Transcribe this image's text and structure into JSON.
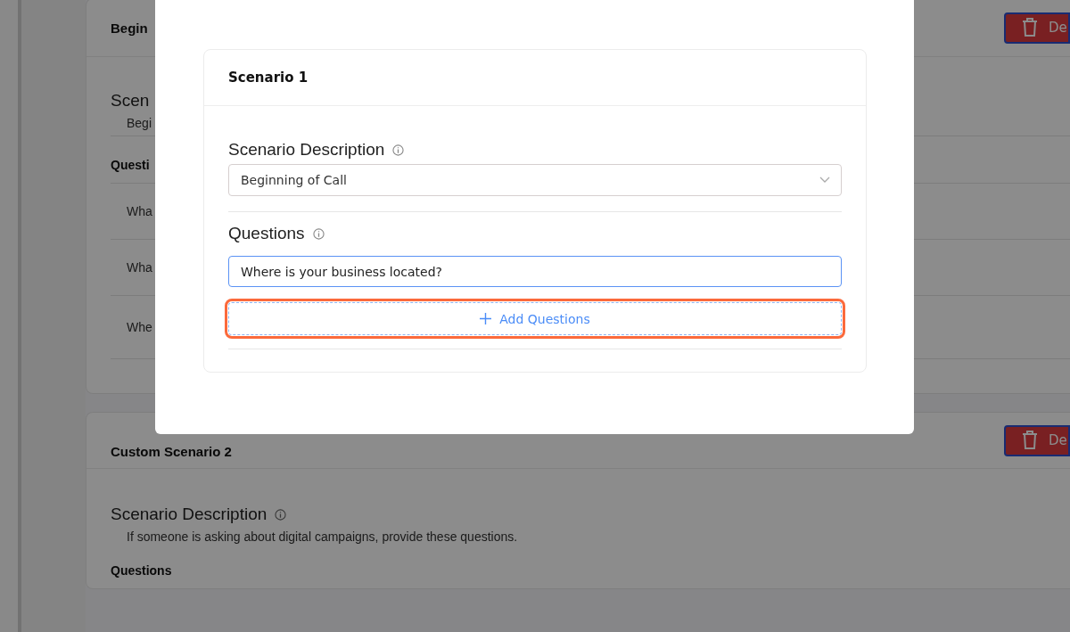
{
  "background": {
    "cards": [
      {
        "title": "Begin",
        "delete_button": "De",
        "section_label": "Scen",
        "description": "Begi",
        "questions_label": "Questi",
        "questions": [
          "Wha",
          "Wha",
          "Whe"
        ]
      },
      {
        "title": "Custom Scenario 2",
        "delete_button": "De",
        "section_label": "Scenario Description",
        "description": "If someone is asking about digital campaigns, provide these questions.",
        "questions_label": "Questions"
      }
    ]
  },
  "modal": {
    "card_title": "Scenario 1",
    "description_label": "Scenario Description",
    "description_value": "Beginning of Call",
    "questions_label": "Questions",
    "question_value": "Where is your business located?",
    "add_button": "Add Questions"
  }
}
